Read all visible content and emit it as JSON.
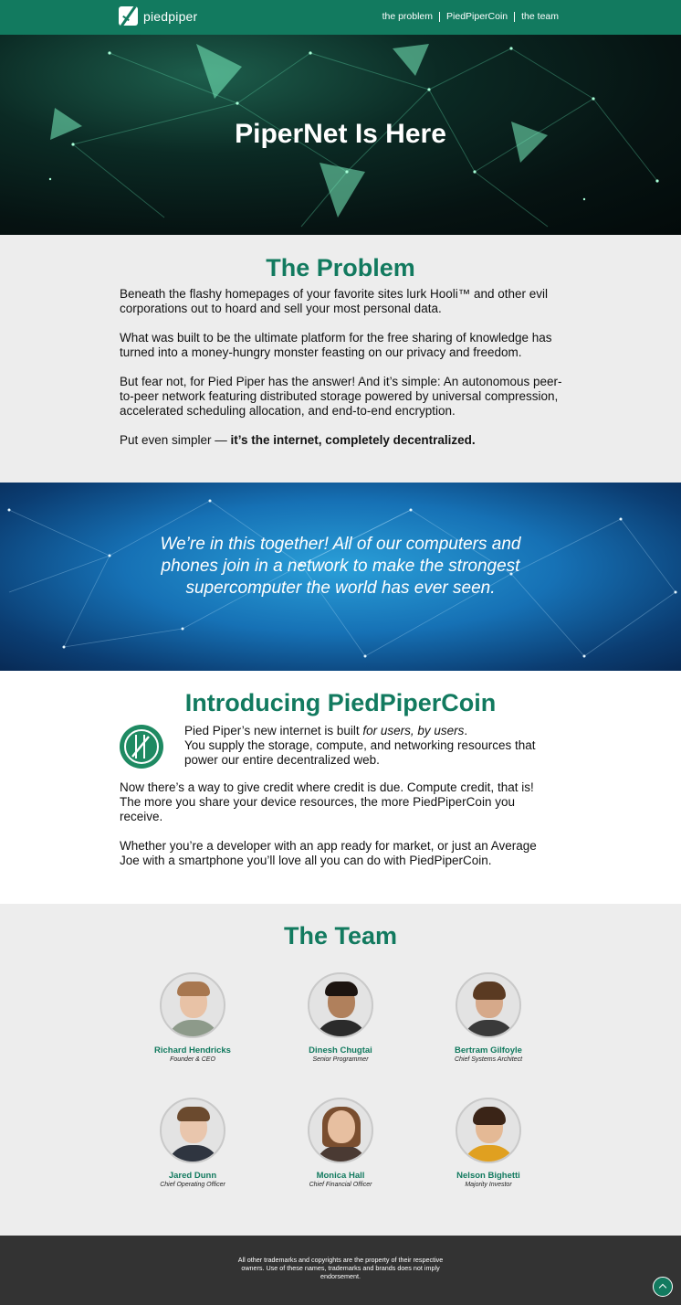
{
  "nav": {
    "logo_text": "piedpiper",
    "links": [
      "the problem",
      "PiedPiperCoin",
      "the team"
    ]
  },
  "hero": {
    "title": "PiperNet Is Here"
  },
  "problem": {
    "title": "The Problem",
    "paragraphs": [
      "Beneath the flashy homepages of your favorite sites lurk Hooli™ and other evil corporations out to hoard and sell your most personal data.",
      "What was built to be the ultimate platform for the free sharing of knowledge has turned into a money-hungry monster feasting on our privacy and freedom.",
      "But fear not, for Pied Piper has the answer! And it’s simple: An autonomous peer-to-peer network featuring distributed storage powered by universal compression, accelerated scheduling allocation, and end-to-end encryption."
    ],
    "final_prefix": "Put even simpler — ",
    "final_bold": "it’s the internet, completely decentralized."
  },
  "banner": {
    "quote": "We’re in this together! All of our computers and phones join in a network to make the strongest supercomputer the world has ever seen."
  },
  "coin": {
    "title": "Introducing PiedPiperCoin",
    "intro_prefix": "Pied Piper’s new internet is built ",
    "intro_italic": "for users, by users",
    "intro_suffix": ".",
    "intro_line2": "You supply the storage, compute, and networking resources that power our entire decentralized web.",
    "paragraphs": [
      "Now there’s a way to give credit where credit is due. Compute credit, that is! The more you share your device resources, the more PiedPiperCoin you receive.",
      "Whether you’re a developer with an app ready for market, or just an Average Joe with a smartphone you’ll love all you can do with PiedPiperCoin."
    ]
  },
  "team": {
    "title": "The Team",
    "members": [
      {
        "name": "Richard Hendricks",
        "role": "Founder & CEO"
      },
      {
        "name": "Dinesh Chugtai",
        "role": "Senior Programmer"
      },
      {
        "name": "Bertram Gilfoyle",
        "role": "Chief Systems Architect"
      },
      {
        "name": "Jared Dunn",
        "role": "Chief Operating Officer"
      },
      {
        "name": "Monica Hall",
        "role": "Chief Financial Officer"
      },
      {
        "name": "Nelson Bighetti",
        "role": "Majority Investor"
      }
    ]
  },
  "footer": {
    "text": "All other trademarks and copyrights are the property of their respective owners. Use of these names, trademarks and brands does not imply endorsement."
  },
  "colors": {
    "brand_green": "#127a5f",
    "section_gray": "#ededed",
    "footer_dark": "#333333"
  },
  "icons": [
    "piedpiper-logo-icon",
    "piedpipercoin-icon",
    "back-to-top-icon"
  ]
}
